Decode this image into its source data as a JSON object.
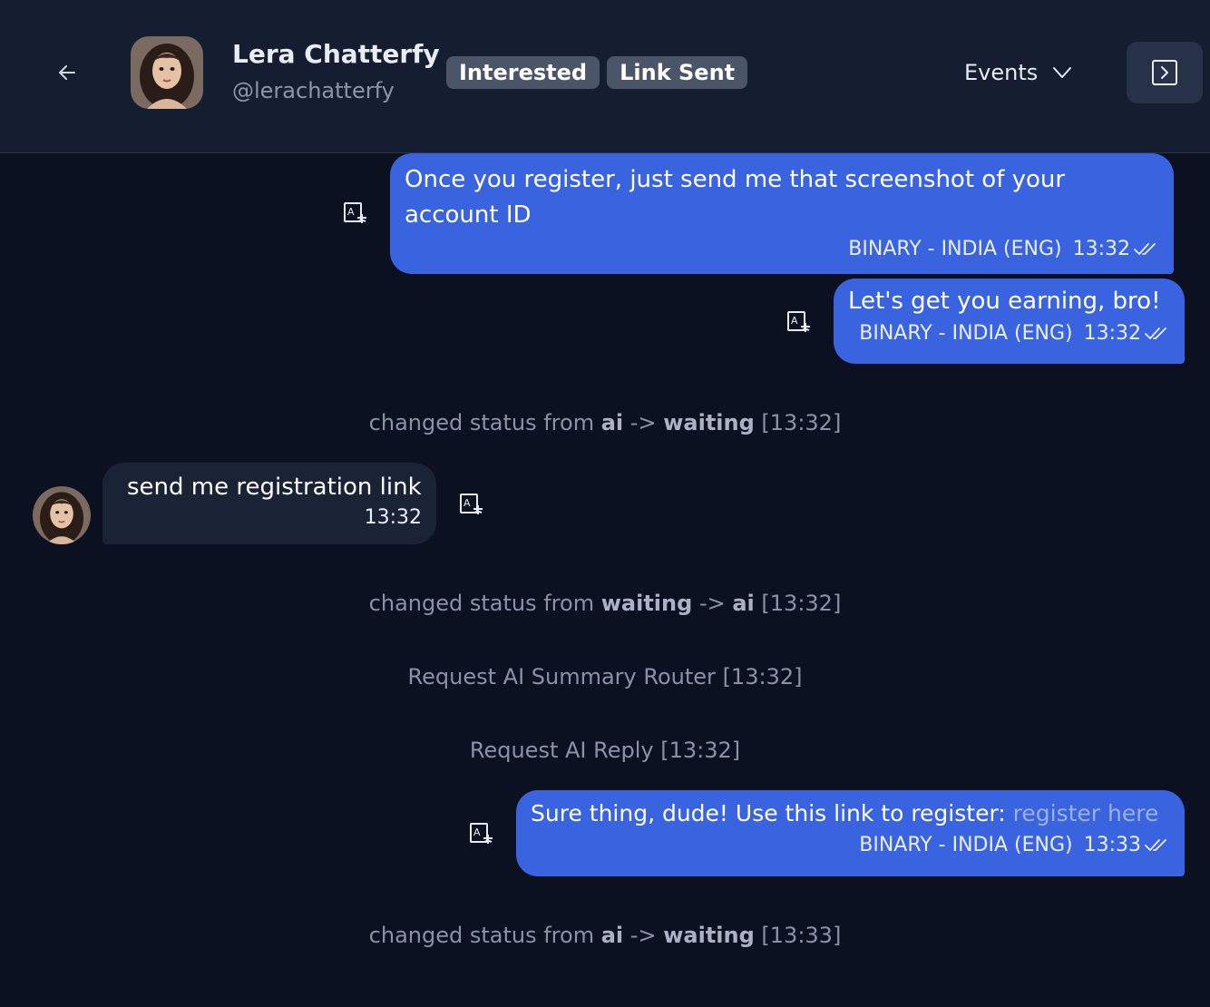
{
  "header": {
    "contact_name": "Lera Chatterfy",
    "contact_handle": "@lerachatterfy",
    "tags": [
      "Interested",
      "Link Sent"
    ],
    "events_label": "Events",
    "icons": {
      "back": "back-arrow-icon",
      "dropdown": "chevron-down-icon",
      "panel": "panel-toggle-icon"
    }
  },
  "messages": {
    "m1": {
      "text": "Once you register, just send me that screenshot of your account ID",
      "label": "BINARY - INDIA (ENG)",
      "time": "13:32"
    },
    "m2": {
      "text": "Let's get you earning, bro!",
      "label": "BINARY - INDIA (ENG)",
      "time": "13:32"
    },
    "m3": {
      "text": "send me registration link",
      "time": "13:32"
    },
    "m4": {
      "text": "Sure thing, dude! Use this link to register:",
      "link": "register here",
      "label": "BINARY - INDIA (ENG)",
      "time": "13:33"
    }
  },
  "events": {
    "e1": {
      "prefix": "changed status from",
      "from": "ai",
      "arrow": "->",
      "to": "waiting",
      "time": "[13:32]"
    },
    "e2": {
      "prefix": "changed status from",
      "from": "waiting",
      "arrow": "->",
      "to": "ai",
      "time": "[13:32]"
    },
    "e3": {
      "text": "Request AI Summary Router",
      "time": "[13:32]"
    },
    "e4": {
      "text": "Request AI Reply",
      "time": "[13:32]"
    },
    "e5": {
      "prefix": "changed status from",
      "from": "ai",
      "arrow": "->",
      "to": "waiting",
      "time": "[13:33]"
    }
  },
  "colors": {
    "background": "#0b1120",
    "header": "#151e31",
    "outgoing_bubble": "#3a63e0",
    "incoming_bubble": "#1a2336",
    "tag": "#4a5568"
  }
}
